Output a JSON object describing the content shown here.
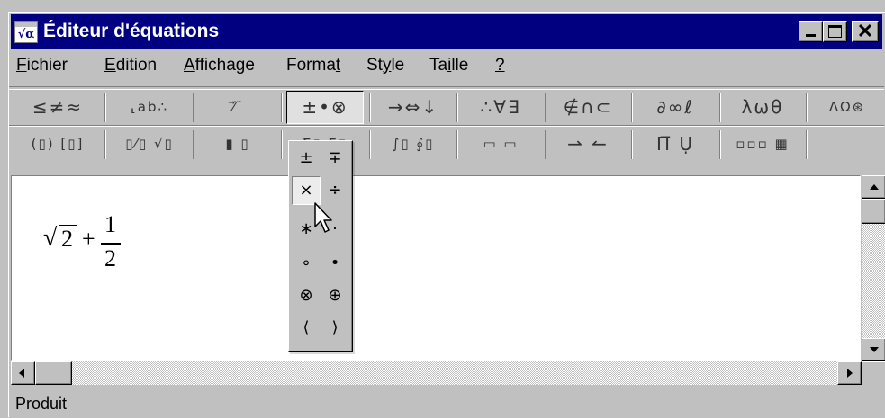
{
  "window": {
    "title": "Éditeur d'équations",
    "app_icon": "√α",
    "controls": [
      "minimize-icon",
      "maximize-icon",
      "close-icon"
    ],
    "close_glyph": "✕"
  },
  "menu": {
    "items": [
      {
        "label": "Fichier"
      },
      {
        "label": "Edition"
      },
      {
        "label": "Affichage"
      },
      {
        "label": "Format"
      },
      {
        "label": "Style"
      },
      {
        "label": "Taille"
      },
      {
        "label": "?"
      }
    ]
  },
  "palettes": {
    "row1": [
      {
        "label": "≤≠≈",
        "name": "relational-symbols"
      },
      {
        "label": "⸤ab∴",
        "name": "spaces-ellipses"
      },
      {
        "label": "⁄⃗ ⃛",
        "name": "embellishments"
      },
      {
        "label": "±•⊗",
        "name": "operator-symbols"
      },
      {
        "label": "→⇔↓",
        "name": "arrow-symbols"
      },
      {
        "label": "∴∀∃",
        "name": "logical-symbols"
      },
      {
        "label": "∉∩⊂",
        "name": "set-theory-symbols"
      },
      {
        "label": "∂∞ℓ",
        "name": "misc-symbols"
      },
      {
        "label": "λωθ",
        "name": "greek-lowercase"
      },
      {
        "label": "ΛΩ⊛",
        "name": "greek-uppercase"
      }
    ],
    "row2": [
      {
        "label": "(▯) [▯]",
        "name": "fence-templates"
      },
      {
        "label": "▯⁄▯ √▯",
        "name": "fraction-radical-templates"
      },
      {
        "label": "▮ ▯",
        "name": "script-templates"
      },
      {
        "label": "Σ▯ Σ▯",
        "name": "summation-templates"
      },
      {
        "label": "∫▯ ∮▯",
        "name": "integral-templates"
      },
      {
        "label": "▭ ▭",
        "name": "bar-templates"
      },
      {
        "label": "⇀ ↼",
        "name": "labeled-arrow-templates"
      },
      {
        "label": "Π̅ Ụ",
        "name": "product-templates"
      },
      {
        "label": "▫▫▫ ▦",
        "name": "matrix-templates"
      }
    ]
  },
  "operators_dropdown": {
    "items": [
      "±",
      "∓",
      "×",
      "÷",
      "∗",
      "·",
      "∘",
      "•",
      "⊗",
      "⊕",
      "⟨",
      "⟩"
    ],
    "selected": "×"
  },
  "document": {
    "formula": {
      "radical": "√",
      "radicand": "2",
      "operator": "+",
      "numerator": "1",
      "denominator": "2"
    }
  },
  "status": {
    "text": "Produit"
  }
}
